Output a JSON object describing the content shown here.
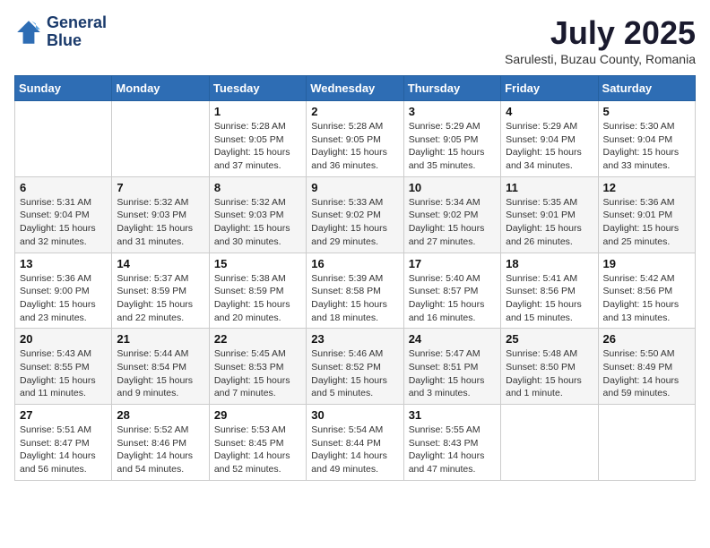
{
  "header": {
    "logo_line1": "General",
    "logo_line2": "Blue",
    "month": "July 2025",
    "location": "Sarulesti, Buzau County, Romania"
  },
  "weekdays": [
    "Sunday",
    "Monday",
    "Tuesday",
    "Wednesday",
    "Thursday",
    "Friday",
    "Saturday"
  ],
  "weeks": [
    [
      {
        "day": "",
        "sunrise": "",
        "sunset": "",
        "daylight": ""
      },
      {
        "day": "",
        "sunrise": "",
        "sunset": "",
        "daylight": ""
      },
      {
        "day": "1",
        "sunrise": "Sunrise: 5:28 AM",
        "sunset": "Sunset: 9:05 PM",
        "daylight": "Daylight: 15 hours and 37 minutes."
      },
      {
        "day": "2",
        "sunrise": "Sunrise: 5:28 AM",
        "sunset": "Sunset: 9:05 PM",
        "daylight": "Daylight: 15 hours and 36 minutes."
      },
      {
        "day": "3",
        "sunrise": "Sunrise: 5:29 AM",
        "sunset": "Sunset: 9:05 PM",
        "daylight": "Daylight: 15 hours and 35 minutes."
      },
      {
        "day": "4",
        "sunrise": "Sunrise: 5:29 AM",
        "sunset": "Sunset: 9:04 PM",
        "daylight": "Daylight: 15 hours and 34 minutes."
      },
      {
        "day": "5",
        "sunrise": "Sunrise: 5:30 AM",
        "sunset": "Sunset: 9:04 PM",
        "daylight": "Daylight: 15 hours and 33 minutes."
      }
    ],
    [
      {
        "day": "6",
        "sunrise": "Sunrise: 5:31 AM",
        "sunset": "Sunset: 9:04 PM",
        "daylight": "Daylight: 15 hours and 32 minutes."
      },
      {
        "day": "7",
        "sunrise": "Sunrise: 5:32 AM",
        "sunset": "Sunset: 9:03 PM",
        "daylight": "Daylight: 15 hours and 31 minutes."
      },
      {
        "day": "8",
        "sunrise": "Sunrise: 5:32 AM",
        "sunset": "Sunset: 9:03 PM",
        "daylight": "Daylight: 15 hours and 30 minutes."
      },
      {
        "day": "9",
        "sunrise": "Sunrise: 5:33 AM",
        "sunset": "Sunset: 9:02 PM",
        "daylight": "Daylight: 15 hours and 29 minutes."
      },
      {
        "day": "10",
        "sunrise": "Sunrise: 5:34 AM",
        "sunset": "Sunset: 9:02 PM",
        "daylight": "Daylight: 15 hours and 27 minutes."
      },
      {
        "day": "11",
        "sunrise": "Sunrise: 5:35 AM",
        "sunset": "Sunset: 9:01 PM",
        "daylight": "Daylight: 15 hours and 26 minutes."
      },
      {
        "day": "12",
        "sunrise": "Sunrise: 5:36 AM",
        "sunset": "Sunset: 9:01 PM",
        "daylight": "Daylight: 15 hours and 25 minutes."
      }
    ],
    [
      {
        "day": "13",
        "sunrise": "Sunrise: 5:36 AM",
        "sunset": "Sunset: 9:00 PM",
        "daylight": "Daylight: 15 hours and 23 minutes."
      },
      {
        "day": "14",
        "sunrise": "Sunrise: 5:37 AM",
        "sunset": "Sunset: 8:59 PM",
        "daylight": "Daylight: 15 hours and 22 minutes."
      },
      {
        "day": "15",
        "sunrise": "Sunrise: 5:38 AM",
        "sunset": "Sunset: 8:59 PM",
        "daylight": "Daylight: 15 hours and 20 minutes."
      },
      {
        "day": "16",
        "sunrise": "Sunrise: 5:39 AM",
        "sunset": "Sunset: 8:58 PM",
        "daylight": "Daylight: 15 hours and 18 minutes."
      },
      {
        "day": "17",
        "sunrise": "Sunrise: 5:40 AM",
        "sunset": "Sunset: 8:57 PM",
        "daylight": "Daylight: 15 hours and 16 minutes."
      },
      {
        "day": "18",
        "sunrise": "Sunrise: 5:41 AM",
        "sunset": "Sunset: 8:56 PM",
        "daylight": "Daylight: 15 hours and 15 minutes."
      },
      {
        "day": "19",
        "sunrise": "Sunrise: 5:42 AM",
        "sunset": "Sunset: 8:56 PM",
        "daylight": "Daylight: 15 hours and 13 minutes."
      }
    ],
    [
      {
        "day": "20",
        "sunrise": "Sunrise: 5:43 AM",
        "sunset": "Sunset: 8:55 PM",
        "daylight": "Daylight: 15 hours and 11 minutes."
      },
      {
        "day": "21",
        "sunrise": "Sunrise: 5:44 AM",
        "sunset": "Sunset: 8:54 PM",
        "daylight": "Daylight: 15 hours and 9 minutes."
      },
      {
        "day": "22",
        "sunrise": "Sunrise: 5:45 AM",
        "sunset": "Sunset: 8:53 PM",
        "daylight": "Daylight: 15 hours and 7 minutes."
      },
      {
        "day": "23",
        "sunrise": "Sunrise: 5:46 AM",
        "sunset": "Sunset: 8:52 PM",
        "daylight": "Daylight: 15 hours and 5 minutes."
      },
      {
        "day": "24",
        "sunrise": "Sunrise: 5:47 AM",
        "sunset": "Sunset: 8:51 PM",
        "daylight": "Daylight: 15 hours and 3 minutes."
      },
      {
        "day": "25",
        "sunrise": "Sunrise: 5:48 AM",
        "sunset": "Sunset: 8:50 PM",
        "daylight": "Daylight: 15 hours and 1 minute."
      },
      {
        "day": "26",
        "sunrise": "Sunrise: 5:50 AM",
        "sunset": "Sunset: 8:49 PM",
        "daylight": "Daylight: 14 hours and 59 minutes."
      }
    ],
    [
      {
        "day": "27",
        "sunrise": "Sunrise: 5:51 AM",
        "sunset": "Sunset: 8:47 PM",
        "daylight": "Daylight: 14 hours and 56 minutes."
      },
      {
        "day": "28",
        "sunrise": "Sunrise: 5:52 AM",
        "sunset": "Sunset: 8:46 PM",
        "daylight": "Daylight: 14 hours and 54 minutes."
      },
      {
        "day": "29",
        "sunrise": "Sunrise: 5:53 AM",
        "sunset": "Sunset: 8:45 PM",
        "daylight": "Daylight: 14 hours and 52 minutes."
      },
      {
        "day": "30",
        "sunrise": "Sunrise: 5:54 AM",
        "sunset": "Sunset: 8:44 PM",
        "daylight": "Daylight: 14 hours and 49 minutes."
      },
      {
        "day": "31",
        "sunrise": "Sunrise: 5:55 AM",
        "sunset": "Sunset: 8:43 PM",
        "daylight": "Daylight: 14 hours and 47 minutes."
      },
      {
        "day": "",
        "sunrise": "",
        "sunset": "",
        "daylight": ""
      },
      {
        "day": "",
        "sunrise": "",
        "sunset": "",
        "daylight": ""
      }
    ]
  ]
}
